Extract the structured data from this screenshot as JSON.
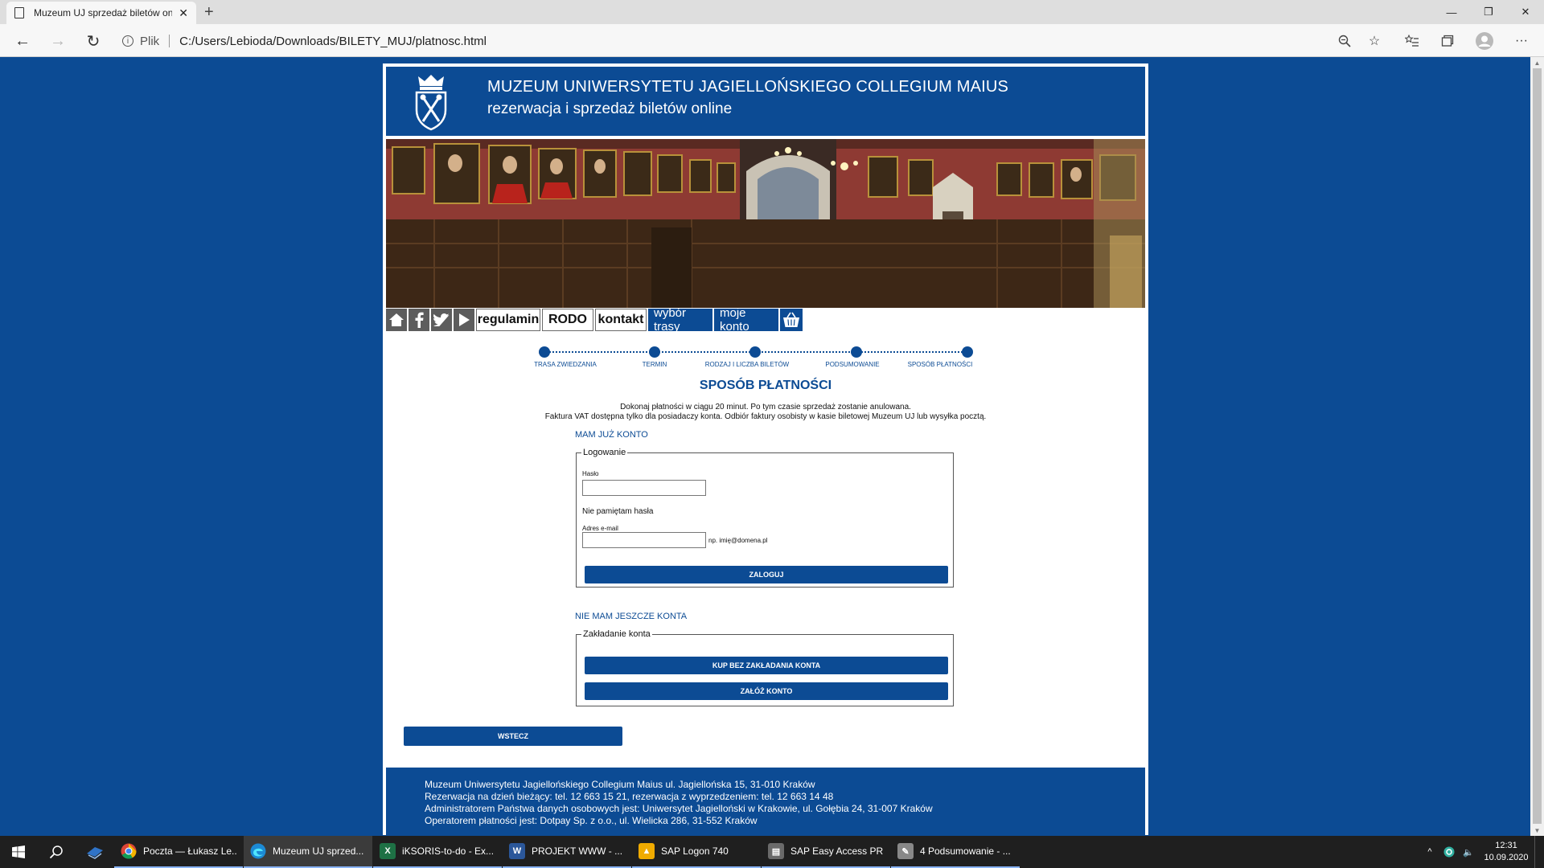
{
  "browser": {
    "tab_title": "Muzeum UJ sprzedaż biletów on",
    "address_scheme_label": "Plik",
    "url": "C:/Users/Lebioda/Downloads/BILETY_MUJ/platnosc.html"
  },
  "site": {
    "header_title": "MUZEUM UNIWERSYTETU JAGIELLOŃSKIEGO COLLEGIUM MAIUS",
    "header_subtitle": "rezerwacja i sprzedaż biletów online",
    "nav": {
      "icons": [
        "home-icon",
        "facebook-icon",
        "twitter-icon",
        "play-icon"
      ],
      "links": [
        "regulamin",
        "RODO",
        "kontakt"
      ],
      "highlighted": [
        "wybór trasy",
        "moje konto"
      ],
      "cart": "basket-icon"
    },
    "steps": [
      "TRASA ZWIEDZANIA",
      "TERMIN",
      "RODZAJ I LICZBA BILETÓW",
      "PODSUMOWANIE",
      "SPOSÓB PŁATNOŚCI"
    ],
    "page_title": "SPOSÓB PŁATNOŚCI",
    "note_line1": "Dokonaj płatności w ciągu 20 minut. Po tym czasie sprzedaż zostanie anulowana.",
    "note_line2": "Faktura VAT dostępna tylko dla posiadaczy konta. Odbiór faktury osobisty w kasie biletowej Muzeum UJ lub wysyłka pocztą.",
    "have_account_link": "MAM JUŻ KONTO",
    "login": {
      "legend": "Logowanie",
      "password_label": "Hasło",
      "password_value": "",
      "forgot": "Nie pamiętam hasła",
      "email_label": "Adres e-mail",
      "email_value": "",
      "email_hint": "np. imię@domena.pl",
      "submit": "ZALOGUJ"
    },
    "no_account_link": "NIE MAM JESZCZE KONTA",
    "register": {
      "legend": "Zakładanie konta",
      "buy_without": "KUP BEZ ZAKŁADANIA KONTA",
      "create": "ZAŁÓŻ KONTO"
    },
    "back_button": "WSTECZ",
    "footer_lines": [
      "Muzeum Uniwersytetu Jagiellońskiego Collegium Maius ul. Jagiellońska 15, 31-010 Kraków",
      "Rezerwacja na dzień bieżący: tel. 12 663 15 21, rezerwacja z wyprzedzeniem: tel. 12 663 14 48",
      "Administratorem Państwa danych osobowych jest: Uniwersytet Jagielloński w Krakowie, ul. Gołębia 24, 31-007 Kraków",
      "Operatorem płatności jest: Dotpay Sp. z o.o., ul. Wielicka 286, 31-552 Kraków"
    ],
    "colors": {
      "brand_blue": "#0c4b94"
    }
  },
  "taskbar": {
    "items": [
      {
        "label": "Poczta — Łukasz Le...",
        "icon": "chrome-icon",
        "color": "#db4437"
      },
      {
        "label": "Muzeum UJ sprzed...",
        "icon": "edge-icon",
        "color": "#1c8ad4"
      },
      {
        "label": "iKSORIS-to-do - Ex...",
        "icon": "excel-icon",
        "color": "#1e7145"
      },
      {
        "label": "PROJEKT WWW - ...",
        "icon": "word-icon",
        "color": "#2b579a"
      },
      {
        "label": "SAP Logon 740",
        "icon": "sap-logon-icon",
        "color": "#f0ab00"
      },
      {
        "label": "SAP Easy Access PR...",
        "icon": "sap-window-icon",
        "color": "#6a6a6a"
      },
      {
        "label": "4 Podsumowanie - ...",
        "icon": "sap-gui-icon",
        "color": "#888888"
      }
    ],
    "clock_time": "12:31",
    "clock_date": "10.09.2020"
  }
}
